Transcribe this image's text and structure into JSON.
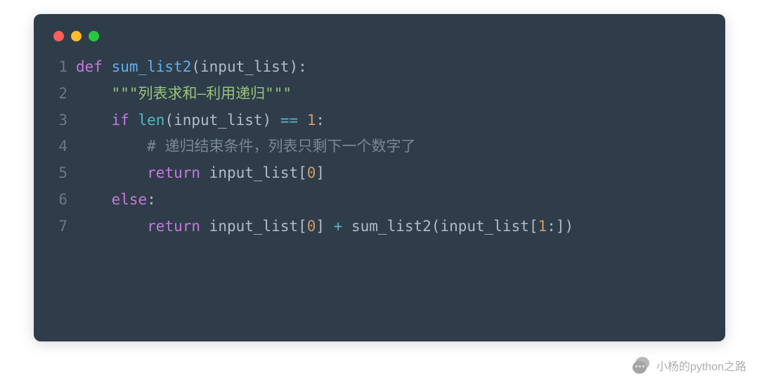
{
  "code": {
    "lines": [
      {
        "no": "1",
        "tokens": [
          {
            "t": "def ",
            "c": "kw"
          },
          {
            "t": "sum_list2",
            "c": "fn"
          },
          {
            "t": "(input_list):",
            "c": "punct"
          }
        ]
      },
      {
        "no": "2",
        "tokens": [
          {
            "t": "    ",
            "c": ""
          },
          {
            "t": "\"\"\"列表求和—利用递归\"\"\"",
            "c": "str"
          }
        ]
      },
      {
        "no": "3",
        "tokens": [
          {
            "t": "    ",
            "c": ""
          },
          {
            "t": "if ",
            "c": "kw"
          },
          {
            "t": "len",
            "c": "builtin"
          },
          {
            "t": "(input_list) ",
            "c": "punct"
          },
          {
            "t": "== ",
            "c": "op"
          },
          {
            "t": "1",
            "c": "num"
          },
          {
            "t": ":",
            "c": "punct"
          }
        ]
      },
      {
        "no": "4",
        "tokens": [
          {
            "t": "        ",
            "c": ""
          },
          {
            "t": "# 递归结束条件，列表只剩下一个数字了",
            "c": "cmt"
          }
        ]
      },
      {
        "no": "5",
        "tokens": [
          {
            "t": "        ",
            "c": ""
          },
          {
            "t": "return ",
            "c": "kw"
          },
          {
            "t": "input_list[",
            "c": "punct"
          },
          {
            "t": "0",
            "c": "num"
          },
          {
            "t": "]",
            "c": "punct"
          }
        ]
      },
      {
        "no": "6",
        "tokens": [
          {
            "t": "    ",
            "c": ""
          },
          {
            "t": "else",
            "c": "kw"
          },
          {
            "t": ":",
            "c": "punct"
          }
        ]
      },
      {
        "no": "7",
        "tokens": [
          {
            "t": "        ",
            "c": ""
          },
          {
            "t": "return ",
            "c": "kw"
          },
          {
            "t": "input_list[",
            "c": "punct"
          },
          {
            "t": "0",
            "c": "num"
          },
          {
            "t": "] ",
            "c": "punct"
          },
          {
            "t": "+ ",
            "c": "op"
          },
          {
            "t": "sum_list2(input_list[",
            "c": "punct"
          },
          {
            "t": "1",
            "c": "num"
          },
          {
            "t": ":])",
            "c": "punct"
          }
        ]
      }
    ]
  },
  "watermark": {
    "text": "小杨的python之路"
  }
}
